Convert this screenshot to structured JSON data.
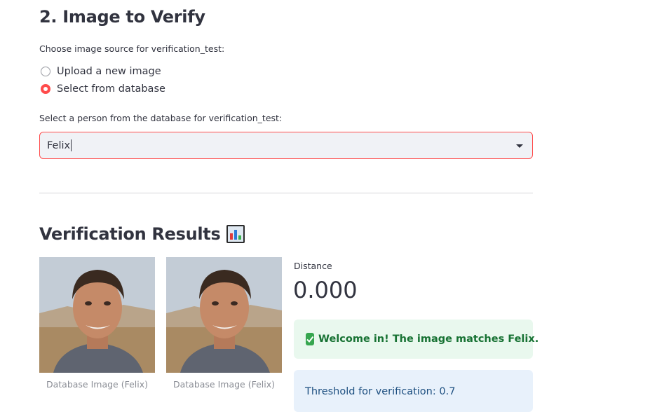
{
  "section": {
    "title": "2. Image to Verify",
    "source_label": "Choose image source for verification_test:",
    "options": [
      "Upload a new image",
      "Select from database"
    ],
    "selected_option": "Select from database",
    "person_label": "Select a person from the database for verification_test:",
    "person_value": "Felix"
  },
  "results": {
    "title": "Verification Results",
    "title_icon": "bar-chart-icon",
    "images": [
      {
        "caption": "Database Image (Felix)"
      },
      {
        "caption": "Database Image (Felix)"
      }
    ],
    "metric_label": "Distance",
    "metric_value": "0.000",
    "success_message": "Welcome in! The image matches Felix.",
    "success_icon": "check-mark-icon",
    "info_message": "Threshold for verification: 0.7"
  },
  "colors": {
    "accent": "#ff4b4b",
    "success_bg": "#e9f8ee",
    "success_text": "#177233",
    "info_bg": "#e8f1fb",
    "info_text": "#1d4f80"
  }
}
